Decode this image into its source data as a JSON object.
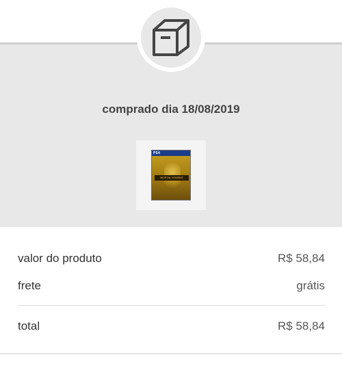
{
  "order": {
    "purchase_label": "comprado dia 18/08/2019",
    "icon": "box-icon",
    "product_image": {
      "icon": "game-cover-image",
      "badge": "PS4",
      "title": "MORTAL KOMBAT"
    }
  },
  "summary": {
    "product_label": "valor do produto",
    "product_value": "R$ 58,84",
    "shipping_label": "frete",
    "shipping_value": "grátis",
    "total_label": "total",
    "total_value": "R$ 58,84"
  },
  "colors": {
    "panel_bg": "#e8e8e8",
    "text_primary": "#333333",
    "text_secondary": "#555555"
  }
}
